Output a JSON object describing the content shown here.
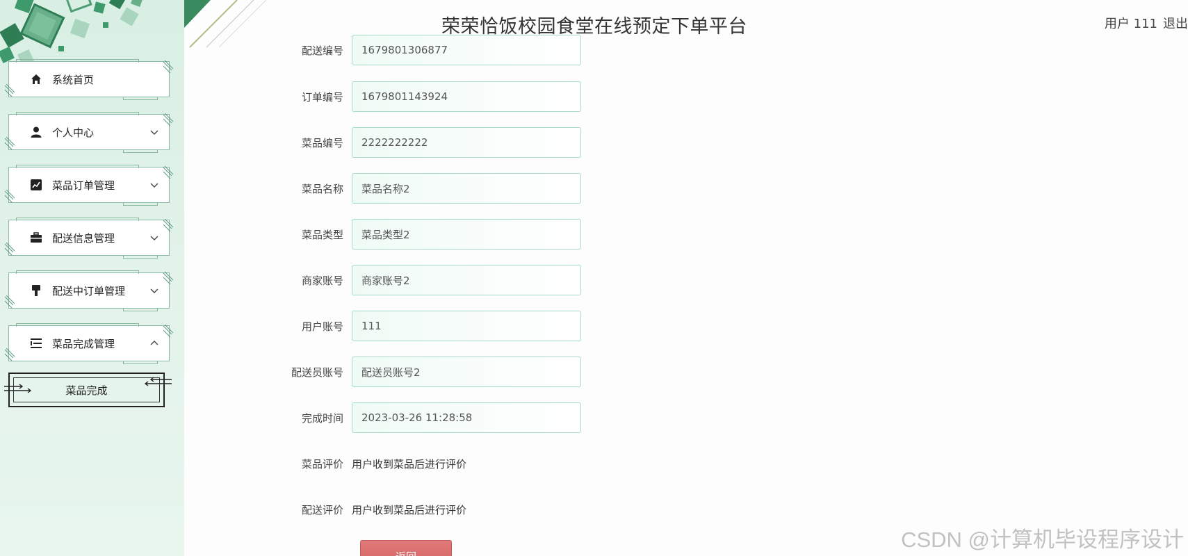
{
  "header": {
    "title": "荣荣恰饭校园食堂在线预定下单平台",
    "user": "用户 111",
    "logout": "退出"
  },
  "sidebar": {
    "items": [
      {
        "label": "系统首页",
        "icon": "home-icon"
      },
      {
        "label": "个人中心",
        "icon": "user-icon"
      },
      {
        "label": "菜品订单管理",
        "icon": "chart-icon"
      },
      {
        "label": "配送信息管理",
        "icon": "briefcase-icon"
      },
      {
        "label": "配送中订单管理",
        "icon": "brush-icon"
      },
      {
        "label": "菜品完成管理",
        "icon": "list-icon"
      }
    ],
    "sub_item": "菜品完成"
  },
  "form": {
    "fields": [
      {
        "label": "配送编号",
        "value": "1679801306877"
      },
      {
        "label": "订单编号",
        "value": "1679801143924"
      },
      {
        "label": "菜品编号",
        "value": "2222222222"
      },
      {
        "label": "菜品名称",
        "value": "菜品名称2"
      },
      {
        "label": "菜品类型",
        "value": "菜品类型2"
      },
      {
        "label": "商家账号",
        "value": "商家账号2"
      },
      {
        "label": "用户账号",
        "value": "111"
      },
      {
        "label": "配送员账号",
        "value": "配送员账号2"
      },
      {
        "label": "完成时间",
        "value": "2023-03-26 11:28:58"
      }
    ],
    "text_fields": [
      {
        "label": "菜品评价",
        "value": "用户收到菜品后进行评价"
      },
      {
        "label": "配送评价",
        "value": "用户收到菜品后进行评价"
      }
    ],
    "back_button": "返回"
  },
  "watermark": "CSDN @计算机毕设程序设计",
  "colors": {
    "sidebar_bg": "#dff1e7",
    "accent_green": "#2e8b57",
    "input_border": "#a7dbc6",
    "back_button": "#d66464"
  }
}
